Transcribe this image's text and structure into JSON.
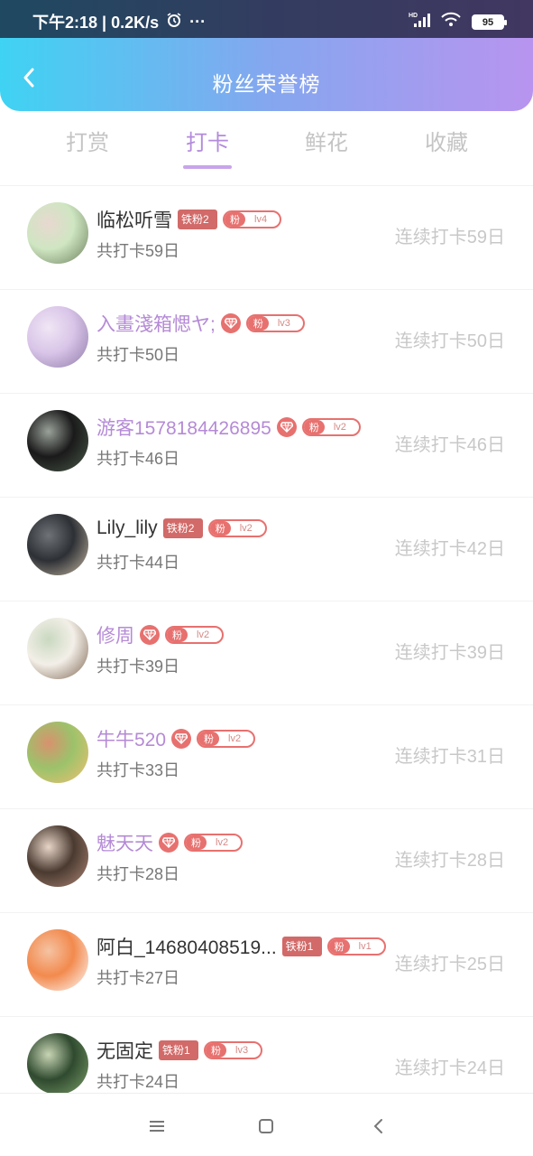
{
  "status_bar": {
    "time_speed": "下午2:18 | 0.2K/s",
    "more": "···",
    "network": "HD",
    "battery": "95"
  },
  "header": {
    "title": "粉丝荣誉榜"
  },
  "tabs": [
    {
      "label": "打赏",
      "active": false
    },
    {
      "label": "打卡",
      "active": true
    },
    {
      "label": "鲜花",
      "active": false
    },
    {
      "label": "收藏",
      "active": false
    }
  ],
  "rows": [
    {
      "name": "临松听雪",
      "vip": false,
      "rank_badge": "铁粉2",
      "diamond": false,
      "fan": "粉",
      "lv": "lv4",
      "total": "共打卡59日",
      "streak": "连续打卡59日",
      "avatar_colors": [
        "#cfe6c2",
        "#6b7d5b",
        "#e8d8d0"
      ]
    },
    {
      "name": "入畫淺箱愢ヤ;",
      "vip": true,
      "rank_badge": "",
      "diamond": true,
      "fan": "粉",
      "lv": "lv3",
      "total": "共打卡50日",
      "streak": "连续打卡50日",
      "avatar_colors": [
        "#d9c5e8",
        "#8e7aa8",
        "#f0e6f5"
      ]
    },
    {
      "name": "游客1578184426895",
      "vip": true,
      "rank_badge": "",
      "diamond": true,
      "fan": "粉",
      "lv": "lv2",
      "total": "共打卡46日",
      "streak": "连续打卡46日",
      "avatar_colors": [
        "#1a1a1a",
        "#4b5a4a",
        "#9aa19a"
      ]
    },
    {
      "name": "Lily_lily",
      "vip": false,
      "rank_badge": "铁粉2",
      "diamond": false,
      "fan": "粉",
      "lv": "lv2",
      "total": "共打卡44日",
      "streak": "连续打卡42日",
      "avatar_colors": [
        "#2d3035",
        "#c7b9a4",
        "#6f7378"
      ]
    },
    {
      "name": "修周",
      "vip": true,
      "rank_badge": "",
      "diamond": true,
      "fan": "粉",
      "lv": "lv2",
      "total": "共打卡39日",
      "streak": "连续打卡39日",
      "avatar_colors": [
        "#f3efe8",
        "#7d6450",
        "#c9d8c0"
      ]
    },
    {
      "name": "牛牛520",
      "vip": true,
      "rank_badge": "",
      "diamond": true,
      "fan": "粉",
      "lv": "lv2",
      "total": "共打卡33日",
      "streak": "连续打卡31日",
      "avatar_colors": [
        "#9cc26b",
        "#f2c070",
        "#d8926e"
      ]
    },
    {
      "name": "魅天天",
      "vip": true,
      "rank_badge": "",
      "diamond": true,
      "fan": "粉",
      "lv": "lv2",
      "total": "共打卡28日",
      "streak": "连续打卡28日",
      "avatar_colors": [
        "#4a3a30",
        "#b08878",
        "#e8d5c8"
      ]
    },
    {
      "name": "阿白_14680408519...",
      "vip": false,
      "rank_badge": "铁粉1",
      "diamond": false,
      "fan": "粉",
      "lv": "lv1",
      "total": "共打卡27日",
      "streak": "连续打卡25日",
      "avatar_colors": [
        "#f28a4e",
        "#ffffff",
        "#f5c3a2"
      ]
    },
    {
      "name": "无固定",
      "vip": false,
      "rank_badge": "铁粉1",
      "diamond": false,
      "fan": "粉",
      "lv": "lv3",
      "total": "共打卡24日",
      "streak": "连续打卡24日",
      "avatar_colors": [
        "#2f4a2f",
        "#7ea06a",
        "#c8d5b4"
      ]
    }
  ],
  "colors": {
    "accent": "#b38bdc",
    "vip_name": "#b58ad6",
    "badge_red": "#e7716f"
  },
  "icons": {
    "back": "chevron-left-icon",
    "alarm": "alarm-icon",
    "signal": "signal-icon",
    "wifi": "wifi-icon",
    "menu": "menu-icon",
    "home": "home-square-icon",
    "nav_back": "nav-back-icon"
  }
}
